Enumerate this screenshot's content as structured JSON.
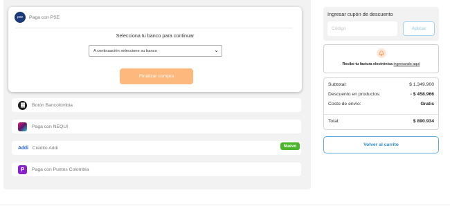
{
  "payment": {
    "pse": {
      "logo_text": "pse",
      "label": "Paga con PSE",
      "bank_prompt": "Selecciona tu banco para continuar",
      "bank_select_value": "A continuación seleccione su banco",
      "finalize_label": "Finalizar compra"
    },
    "methods": {
      "bancolombia": "Botón Bancolombia",
      "nequi": "Paga con NEQUI",
      "addi_logo": "Addi",
      "addi": "Crédito Addi",
      "addi_badge": "Nuevo",
      "puntos": "Paga con Puntos Colombia",
      "puntos_icon": "P"
    }
  },
  "coupon": {
    "title": "Ingresar cupón de descuento",
    "placeholder": "Código",
    "apply_label": "Aplicar"
  },
  "invoice": {
    "bold_text": "Recibe tu factura electrónica",
    "link_text": "ingresando aquí"
  },
  "summary": {
    "subtotal_label": "Subtotal:",
    "subtotal_value": "$ 1.349.900",
    "discount_label": "Descuento en productos:",
    "discount_value": "- $ 458.966",
    "shipping_label": "Costo de envío:",
    "shipping_value": "Gratis",
    "total_label": "Total:",
    "total_value": "$ 890.934"
  },
  "back_label": "Volver al carrito",
  "colors": {
    "accent_orange": "#fdb97d",
    "link_blue": "#2b8ad1",
    "badge_green": "#49b629",
    "addi_blue": "#2b62d9"
  }
}
